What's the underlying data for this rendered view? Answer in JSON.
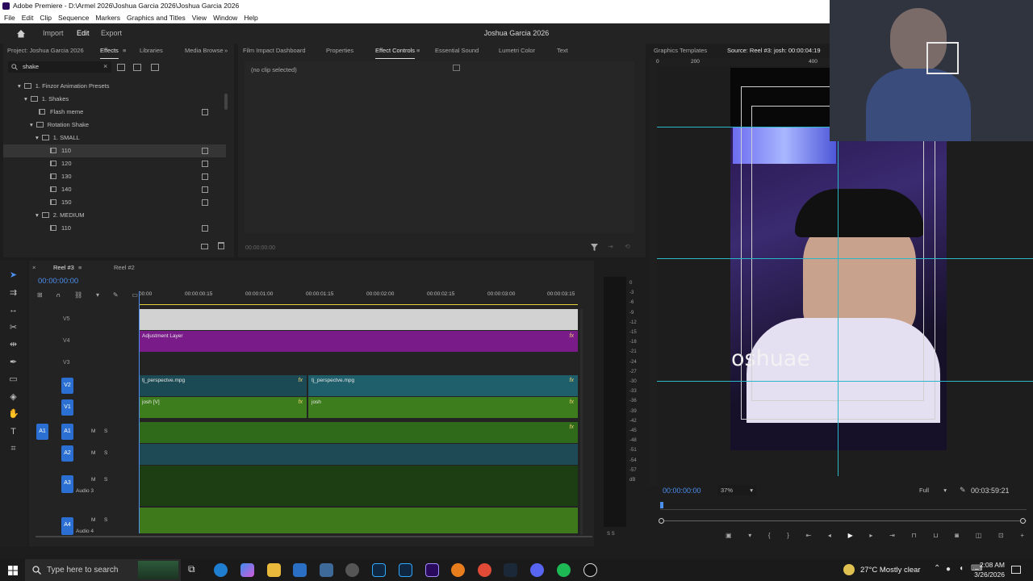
{
  "window": {
    "title": "Adobe Premiere - D:\\Armel 2026\\Joshua Garcia 2026\\Joshua Garcia 2026",
    "menu": [
      "File",
      "Edit",
      "Clip",
      "Sequence",
      "Markers",
      "Graphics and Titles",
      "View",
      "Window",
      "Help"
    ]
  },
  "workspace": {
    "tabs": [
      "Import",
      "Edit",
      "Export"
    ],
    "active_tab": "Edit",
    "project_title": "Joshua Garcia 2026"
  },
  "effects_panel": {
    "tabs": [
      "Project: Joshua Garcia 2026",
      "Effects",
      "Libraries",
      "Media Browse"
    ],
    "search_value": "shake",
    "tree": [
      {
        "label": "1. Finzor Animation Presets",
        "type": "folder",
        "depth": 1
      },
      {
        "label": "1. Shakes",
        "type": "folder",
        "depth": 2
      },
      {
        "label": "Flash meme",
        "type": "preset",
        "depth": 3
      },
      {
        "label": "Rotation Shake",
        "type": "folder",
        "depth": 3
      },
      {
        "label": "1. SMALL",
        "type": "folder",
        "depth": 4
      },
      {
        "label": "110",
        "type": "preset",
        "depth": 5,
        "selected": true
      },
      {
        "label": "120",
        "type": "preset",
        "depth": 5
      },
      {
        "label": "130",
        "type": "preset",
        "depth": 5
      },
      {
        "label": "140",
        "type": "preset",
        "depth": 5
      },
      {
        "label": "150",
        "type": "preset",
        "depth": 5
      },
      {
        "label": "2. MEDIUM",
        "type": "folder",
        "depth": 4
      },
      {
        "label": "110",
        "type": "preset",
        "depth": 5
      }
    ]
  },
  "effect_controls_panel": {
    "tabs": [
      "Film Impact Dashboard",
      "Properties",
      "Effect Controls",
      "Essential Sound",
      "Lumetri Color",
      "Text"
    ],
    "empty_text": "(no clip selected)",
    "timecode": "00:00:00:00"
  },
  "program_panel": {
    "tabs": [
      "Graphics Templates",
      "Source: Reel #3: josh: 00:00:04:19"
    ],
    "ruler_labels": [
      "0",
      "200",
      "400"
    ],
    "overlay_text": "oshuae",
    "timecode": "00:00:00:00",
    "zoom": "37%",
    "resolution": "Full",
    "duration": "00:03:59:21"
  },
  "timeline": {
    "tabs": [
      "Reel #3",
      "Reel #2"
    ],
    "timecode": "00:00:00:00",
    "ruler": [
      "00:00",
      "00:00:00:15",
      "00:00:01:00",
      "00:00:01:15",
      "00:00:02:00",
      "00:00:02:15",
      "00:00:03:00",
      "00:00:03:15"
    ],
    "video_tracks": [
      "V5",
      "V4",
      "V3",
      "V2",
      "V1"
    ],
    "audio_tracks": [
      "A1",
      "A2",
      "A3",
      "A4"
    ],
    "audio_names": [
      "Audio 3",
      "Audio 4"
    ],
    "track_buttons": [
      "M",
      "S"
    ],
    "clips": {
      "adjustment": "Adjustment Layer",
      "v2_a": "tj_perspectve.mpg",
      "v2_b": "tj_perspectve.mpg",
      "v1_a": "josh [V]",
      "v1_b": "josh",
      "fx": "fx"
    }
  },
  "meter": {
    "scale": [
      "0",
      "-3",
      "-6",
      "-9",
      "-12",
      "-15",
      "-18",
      "-21",
      "-24",
      "-27",
      "-30",
      "-33",
      "-36",
      "-39",
      "-42",
      "-45",
      "-48",
      "-51",
      "-54",
      "-57",
      "dB"
    ],
    "solo": "S S"
  },
  "taskbar": {
    "search_placeholder": "Type here to search",
    "weather": "27°C  Mostly clear",
    "time": "2:08 AM",
    "date": "3/26/2026"
  }
}
